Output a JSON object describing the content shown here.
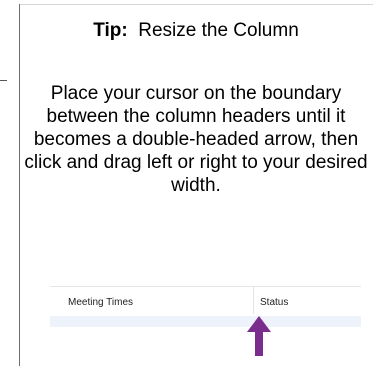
{
  "tip": {
    "title_bold": "Tip:",
    "title_rest": "Resize the Column",
    "body": "Place your cursor on the boundary between the column headers until it becomes a double-headed arrow, then click and drag left or right to your desired width."
  },
  "column_headers": {
    "meeting_times": "Meeting Times",
    "status": "Status"
  },
  "colors": {
    "arrow": "#7b2d8e",
    "header_row_bg": "#eef3fb"
  },
  "icons": {
    "arrow": "up-arrow-icon"
  }
}
